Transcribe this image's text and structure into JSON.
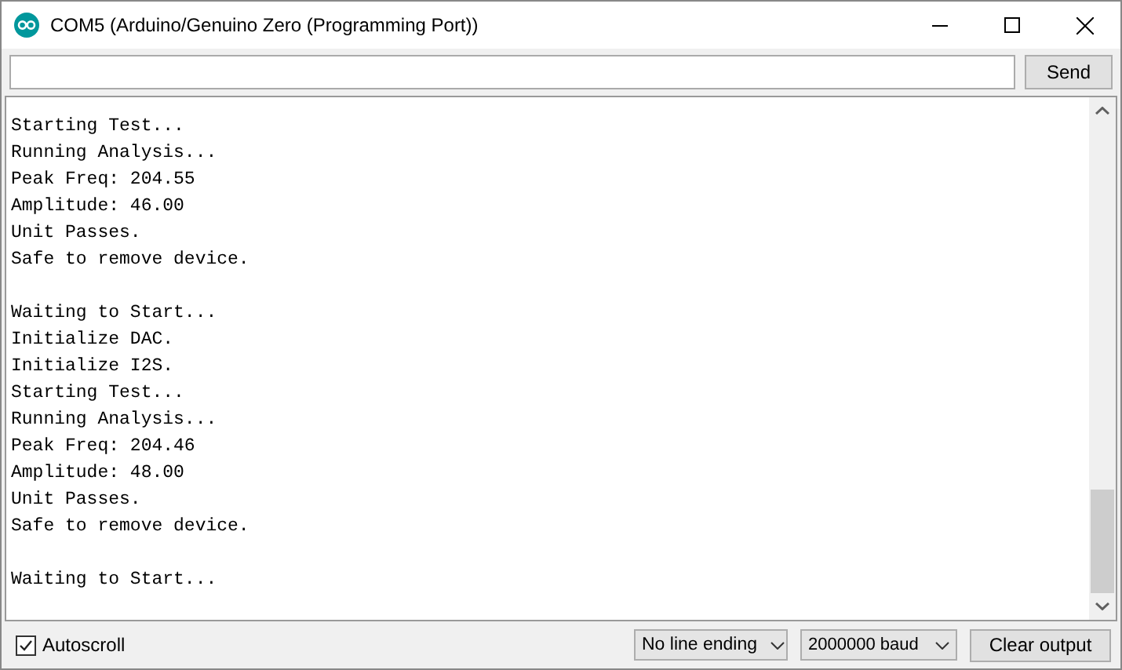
{
  "window": {
    "title": "COM5 (Arduino/Genuino Zero (Programming Port))"
  },
  "send_button": "Send",
  "output_blocks": [
    [
      "Starting Test...",
      "Running Analysis...",
      "Peak Freq: 204.55",
      "Amplitude: 46.00",
      "Unit Passes.",
      "Safe to remove device."
    ],
    [
      "Waiting to Start...",
      "Initialize DAC.",
      "Initialize I2S.",
      "Starting Test...",
      "Running Analysis...",
      "Peak Freq: 204.46",
      "Amplitude: 48.00",
      "Unit Passes.",
      "Safe to remove device."
    ],
    [
      "Waiting to Start..."
    ]
  ],
  "autoscroll": {
    "label": "Autoscroll",
    "checked": true
  },
  "line_ending": "No line ending",
  "baud": "2000000 baud",
  "clear_button": "Clear output"
}
